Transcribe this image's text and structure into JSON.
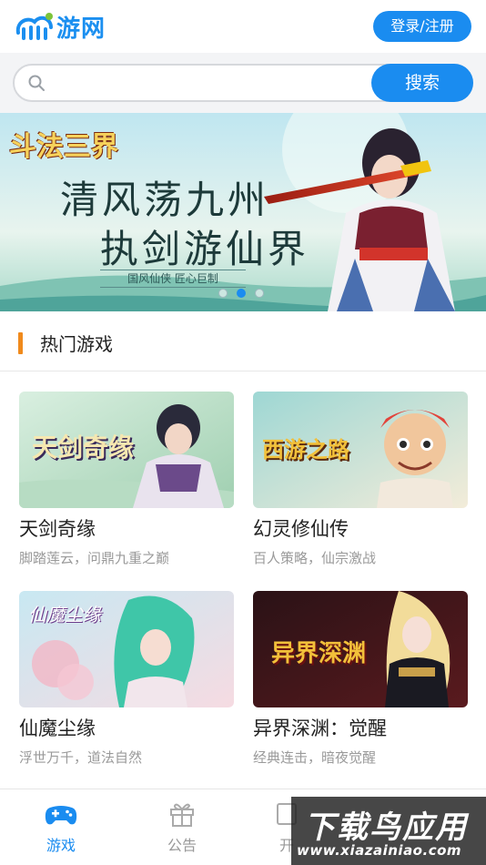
{
  "header": {
    "logo_text": "游网",
    "login_label": "登录/注册"
  },
  "search": {
    "placeholder": "",
    "button_label": "搜索"
  },
  "banner": {
    "logo_text": "斗法三界",
    "slogan_line1": "清风荡九州",
    "slogan_line2": "执剑游仙界",
    "tagline": "国风仙侠  匠心巨制",
    "slide_count": 3,
    "active_slide": 2
  },
  "section": {
    "title": "热门游戏"
  },
  "games": [
    {
      "name": "天剑奇缘",
      "desc": "脚踏莲云，问鼎九重之巅",
      "thumb_text": "天剑奇缘"
    },
    {
      "name": "幻灵修仙传",
      "desc": "百人策略，仙宗激战",
      "thumb_text": "西游之路"
    },
    {
      "name": "仙魔尘缘",
      "desc": "浮世万千，道法自然",
      "thumb_text": "仙魔尘缘"
    },
    {
      "name": "异界深渊：觉醒",
      "desc": "经典连击，暗夜觉醒",
      "thumb_text": "异界深渊"
    }
  ],
  "tabbar": {
    "items": [
      {
        "label": "游戏",
        "icon": "gamepad-icon",
        "active": true
      },
      {
        "label": "公告",
        "icon": "gift-icon",
        "active": false
      },
      {
        "label": "开",
        "icon": "server-icon",
        "active": false
      }
    ]
  },
  "watermark": {
    "title": "下载鸟应用",
    "url": "www.xiazainiao.com"
  },
  "colors": {
    "accent": "#1a8cf0",
    "section_bar": "#f08a1c",
    "muted_text": "#9a9a9a"
  }
}
